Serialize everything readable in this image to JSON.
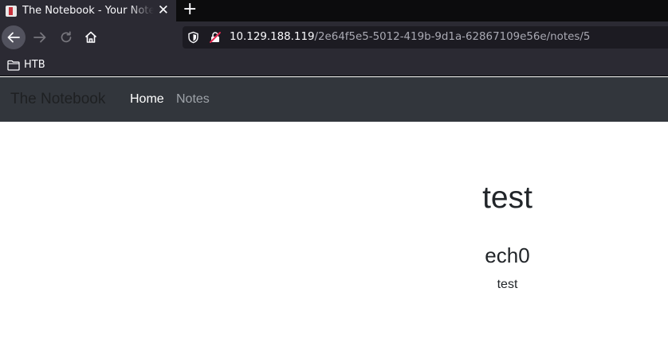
{
  "browser": {
    "tab": {
      "title": "The Notebook - Your Notes",
      "close": "✕"
    },
    "new_tab": "+",
    "url": {
      "host": "10.129.188.119",
      "path": "/2e64f5e5-5012-419b-9d1a-62867109e56e/notes/5"
    },
    "bookmarks": [
      {
        "label": "HTB"
      }
    ]
  },
  "site": {
    "brand": "The Notebook",
    "nav": {
      "home": "Home",
      "notes": "Notes"
    }
  },
  "note": {
    "title": "test",
    "author": "ech0",
    "body": "test"
  },
  "colors": {
    "site_navbar": "#32363c",
    "browser_chrome": "#2b2a33",
    "tabbar": "#0c0c0d",
    "text": "#212529"
  }
}
